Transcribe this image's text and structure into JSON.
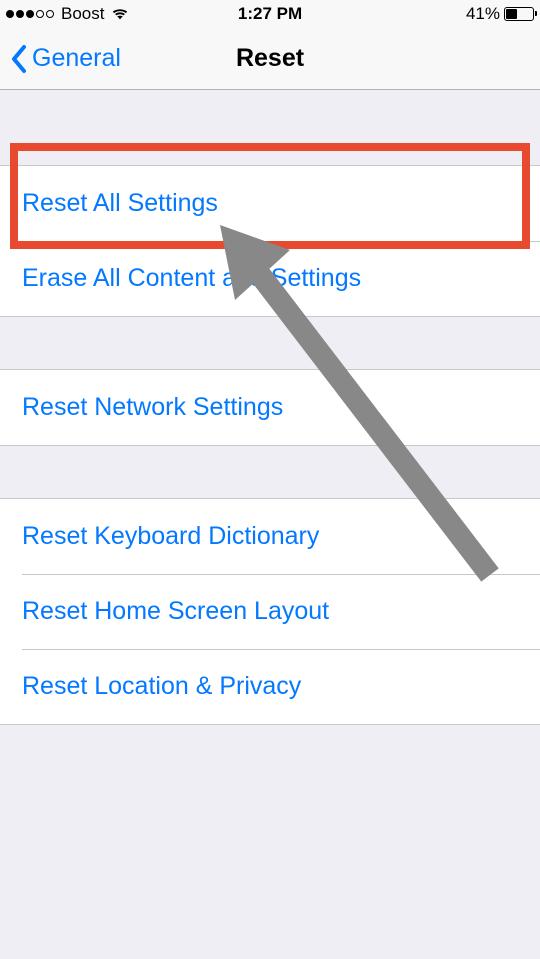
{
  "status_bar": {
    "carrier": "Boost",
    "time": "1:27 PM",
    "battery_text": "41%"
  },
  "nav": {
    "back_label": "General",
    "title": "Reset"
  },
  "groups": [
    {
      "rows": [
        {
          "label": "Reset All Settings"
        },
        {
          "label": "Erase All Content and Settings"
        }
      ]
    },
    {
      "rows": [
        {
          "label": "Reset Network Settings"
        }
      ]
    },
    {
      "rows": [
        {
          "label": "Reset Keyboard Dictionary"
        },
        {
          "label": "Reset Home Screen Layout"
        },
        {
          "label": "Reset Location & Privacy"
        }
      ]
    }
  ]
}
